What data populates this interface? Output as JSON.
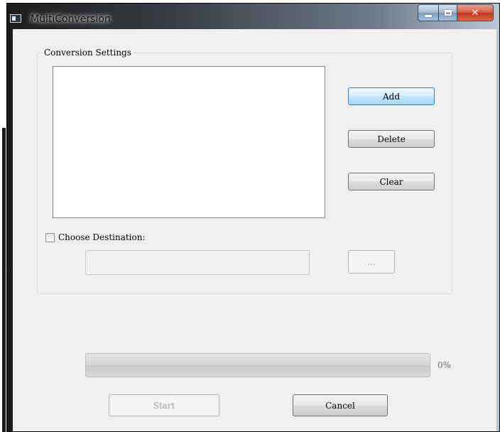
{
  "window": {
    "title": "MultiConversion"
  },
  "group": {
    "title": "Conversion Settings",
    "list_items": []
  },
  "buttons": {
    "add": "Add",
    "delete": "Delete",
    "clear": "Clear",
    "browse": "...",
    "start": "Start",
    "cancel": "Cancel"
  },
  "destination": {
    "checkbox_label": "Choose Destination:",
    "checked": false,
    "value": ""
  },
  "progress": {
    "fraction": 0,
    "label": "0%"
  },
  "colors": {
    "client_bg": "#f0f0f0",
    "focus_border": "#3c7fb1",
    "disabled_text": "#a0a0a0"
  }
}
